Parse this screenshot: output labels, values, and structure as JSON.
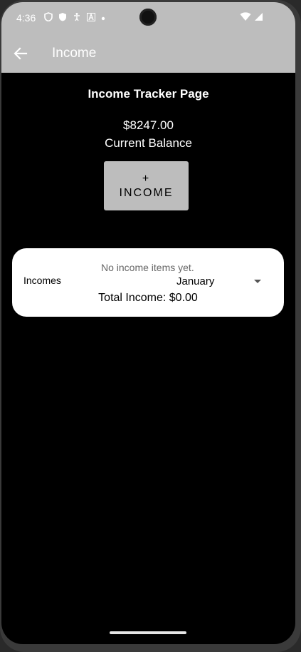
{
  "status_bar": {
    "time": "4:36"
  },
  "app_bar": {
    "title": "Income"
  },
  "page": {
    "title": "Income Tracker Page",
    "balance_amount": "$8247.00",
    "balance_label": "Current Balance",
    "add_button_plus": "+",
    "add_button_label": "INCOME"
  },
  "income_card": {
    "label": "Incomes",
    "empty_message": "No income items yet.",
    "selected_month": "January",
    "total": "Total Income: $0.00"
  },
  "colors": {
    "app_bar": "#bdbdbd",
    "background": "#000000",
    "card": "#ffffff",
    "button": "#bdbdbd"
  }
}
